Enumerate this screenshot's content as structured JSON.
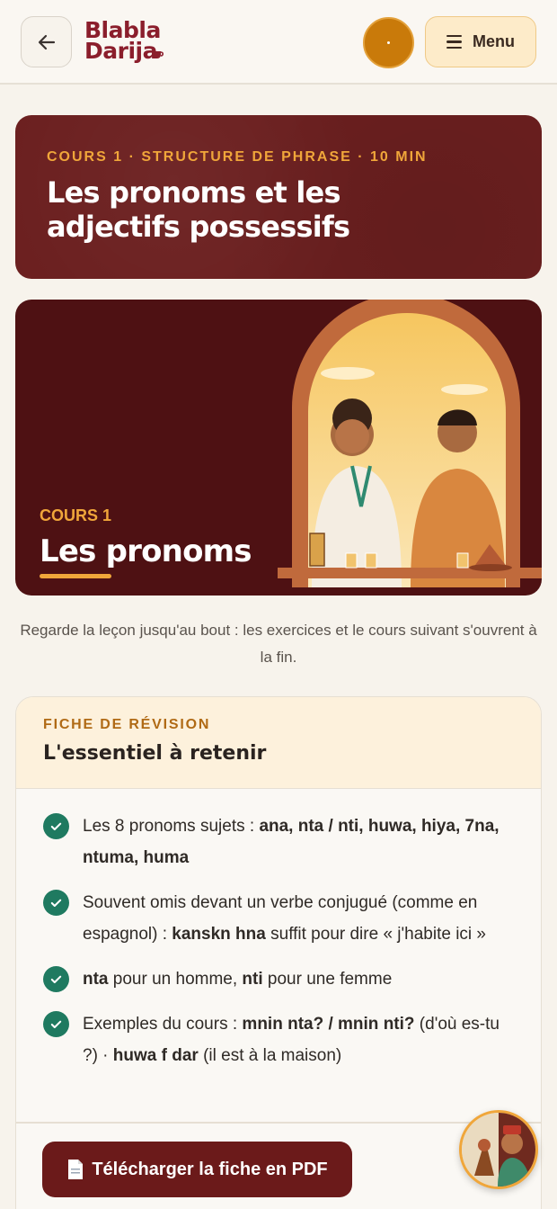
{
  "header": {
    "logo_line1": "Blabla",
    "logo_line2": "Darija",
    "menu_label": "Menu"
  },
  "lesson": {
    "kicker": "COURS 1 · STRUCTURE DE PHRASE · 10 MIN",
    "title": "Les pronoms et les adjectifs possessifs"
  },
  "video": {
    "kicker": "COURS 1",
    "title": "Les pronoms"
  },
  "note": "Regarde la leçon jusqu'au bout : les exercices et le cours suivant s'ouvrent à la fin.",
  "sheet": {
    "kicker": "FICHE DE RÉVISION",
    "title": "L'essentiel à retenir",
    "items": [
      [
        {
          "t": "Les 8 pronoms sujets : "
        },
        {
          "t": "ana, nta / nti, huwa, hiya, 7na, ntuma, huma",
          "b": true
        }
      ],
      [
        {
          "t": "Souvent omis devant un verbe conjugué (comme en espagnol) : "
        },
        {
          "t": "kanskn hna",
          "b": true
        },
        {
          "t": " suffit pour dire « j'habite ici »"
        }
      ],
      [
        {
          "t": "nta",
          "b": true
        },
        {
          "t": " pour un homme, "
        },
        {
          "t": "nti",
          "b": true
        },
        {
          "t": " pour une femme"
        }
      ],
      [
        {
          "t": "Exemples du cours : "
        },
        {
          "t": "mnin nta? / mnin nti?",
          "b": true
        },
        {
          "t": " (d'où es-tu ?) · "
        },
        {
          "t": "huwa f dar",
          "b": true
        },
        {
          "t": " (il est à la maison)"
        }
      ]
    ]
  },
  "pdf_button": {
    "icon": "document-icon",
    "label": "Télécharger la fiche en PDF"
  },
  "colors": {
    "brand": "#8b1e2c",
    "accent": "#f0a63a",
    "check": "#1f7a60"
  }
}
